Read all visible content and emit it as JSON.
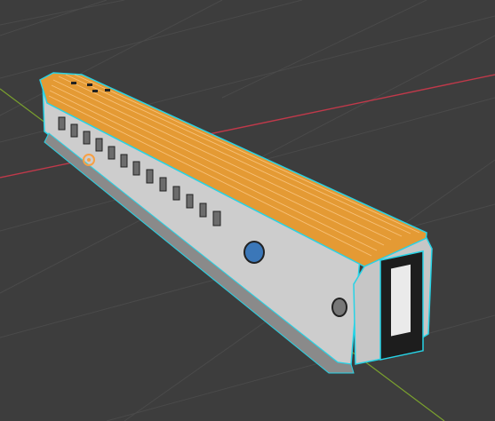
{
  "viewport": {
    "background": "#3d3d3d",
    "grid_color": "#4a4a4a",
    "x_axis_color": "#c0394a",
    "y_axis_color": "#7aa02e",
    "selection_outline": "#27d3e6",
    "roof_color": "#e5952e",
    "body_color": "#cfcfcf",
    "origin_marker": "#f7a044"
  },
  "object": {
    "kind": "passenger-railcar",
    "state": "selected-edit-wireframe"
  }
}
